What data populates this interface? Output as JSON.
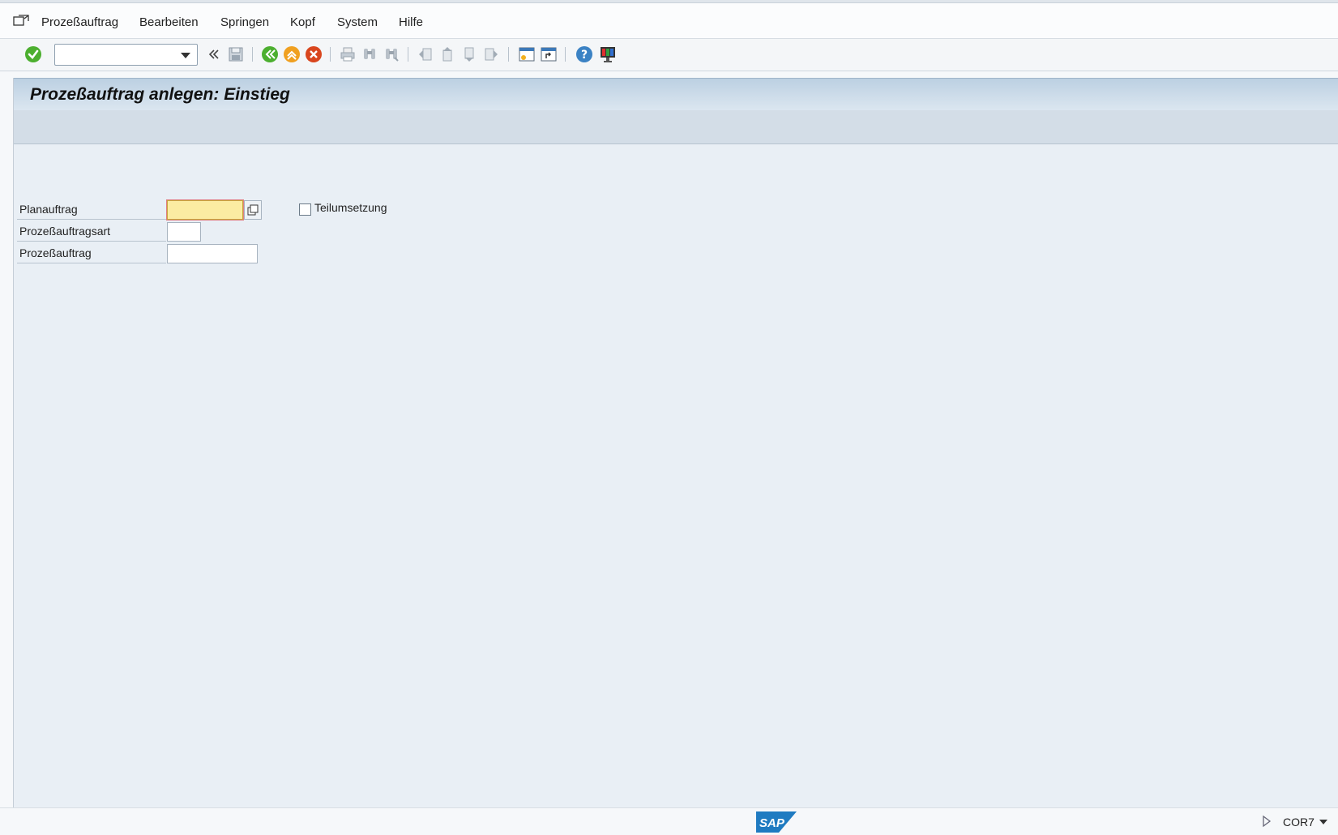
{
  "menu": {
    "items": [
      {
        "label": "Prozeßauftrag"
      },
      {
        "label": "Bearbeiten"
      },
      {
        "label": "Springen"
      },
      {
        "label": "Kopf"
      },
      {
        "label": "System"
      },
      {
        "label": "Hilfe"
      }
    ]
  },
  "toolbar": {
    "command_field": {
      "value": "",
      "placeholder": ""
    },
    "icons": [
      "enter-icon",
      "command-dropdown",
      "collapse-icon",
      "save-icon",
      "back-icon",
      "exit-icon",
      "cancel-icon",
      "print-icon",
      "find-icon",
      "find-next-icon",
      "first-page-icon",
      "previous-page-icon",
      "next-page-icon",
      "last-page-icon",
      "new-session-icon",
      "shortcut-icon",
      "help-icon",
      "customize-layout-icon"
    ]
  },
  "screen": {
    "title": "Prozeßauftrag anlegen: Einstieg"
  },
  "form": {
    "planauftrag": {
      "label": "Planauftrag",
      "value": ""
    },
    "teilumsetzung": {
      "label": "Teilumsetzung",
      "checked": false
    },
    "auftragsart": {
      "label": "Prozeßauftragsart",
      "value": ""
    },
    "prozessauftrag": {
      "label": "Prozeßauftrag",
      "value": ""
    }
  },
  "status": {
    "logo_text": "SAP",
    "system": "COR7"
  },
  "colors": {
    "accent_green": "#4caf2f",
    "accent_orange": "#f0a020",
    "accent_red": "#d9461e",
    "help_blue": "#3b82c4",
    "sap_blue": "#1f7bc1",
    "focus_yellow": "#fbeca2"
  }
}
